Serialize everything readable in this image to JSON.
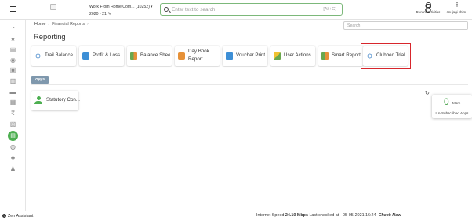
{
  "topbar": {
    "company_line1": "Work From Home Com... (10252)",
    "company_line2": "2020 - 21",
    "search_placeholder": "Enter text to search",
    "search_shortcut": "[Alt+G]",
    "recent_badge": "8",
    "recent_label": "Recent Activities",
    "user_label": "anujagi.shim.."
  },
  "breadcrumb": {
    "home": "Home",
    "current": "Financial Reports"
  },
  "filter_placeholder": "Search",
  "page_title": "Reporting",
  "reports": [
    {
      "label": "Trail Balance..."
    },
    {
      "label": "Profit & Loss..."
    },
    {
      "label": "Balance Sheet..."
    },
    {
      "label": "Day Book Report"
    },
    {
      "label": "Voucher Print..."
    },
    {
      "label": "User Actions ..."
    },
    {
      "label": "Smart Report"
    },
    {
      "label": "Clubbed Trial..."
    }
  ],
  "apps_tab": "Apps",
  "apps": [
    {
      "label": "Statutory Con..."
    }
  ],
  "unsubscribed": {
    "count": "0",
    "more": "More",
    "label": "Un-Subscribed Apps"
  },
  "statusbar": {
    "zen": "Zen Assistant",
    "speed_prefix": "Internet Speed",
    "speed_value": "24.10 Mbps",
    "last_checked": "Last checked at - 05-05-2021 16:24",
    "check_now": "Check Now"
  },
  "colors": {
    "accent_green": "#4caf50",
    "highlight_red": "#d7262c",
    "apps_tab": "#7f98ad"
  }
}
